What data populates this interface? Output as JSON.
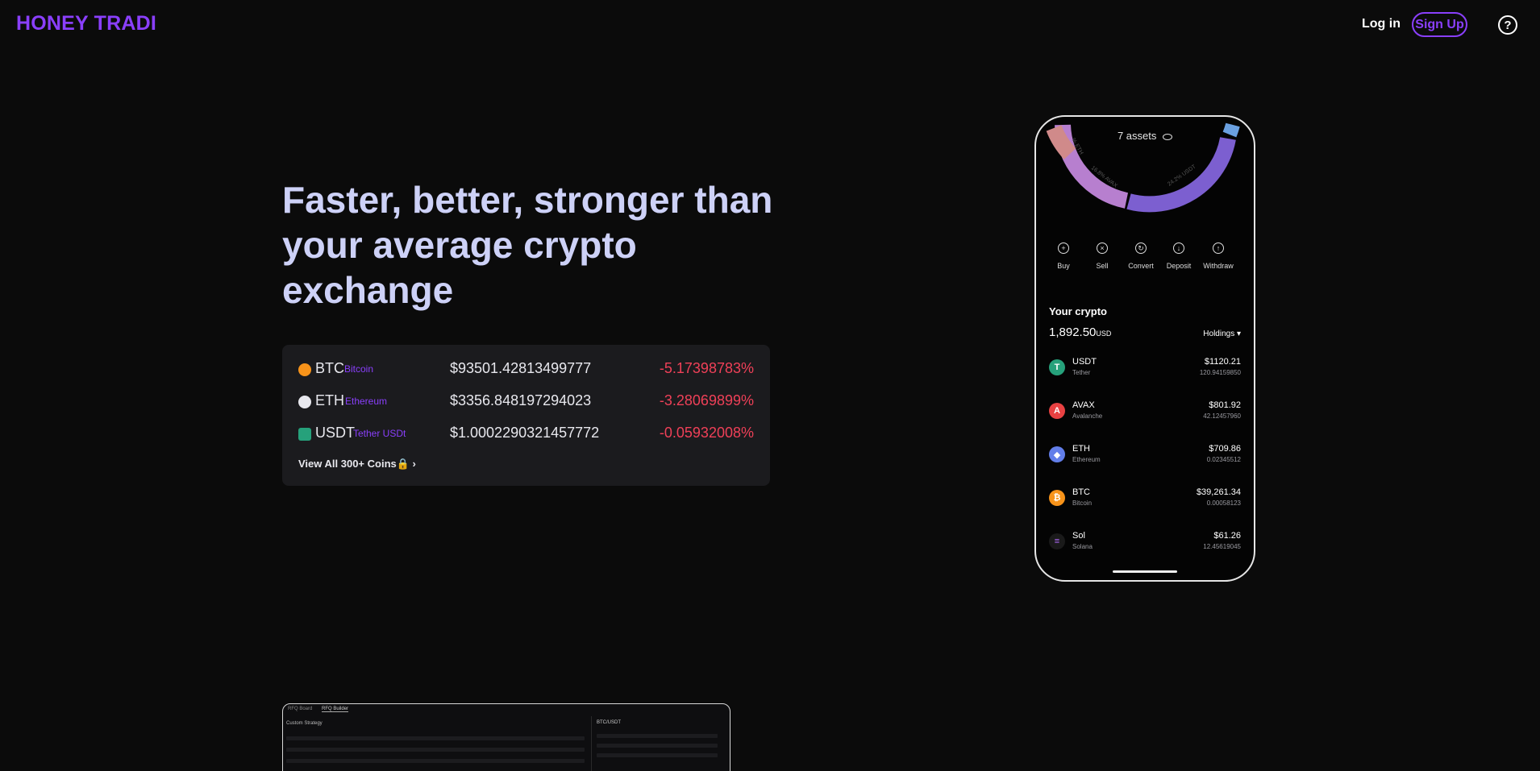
{
  "nav": {
    "brand": "HONEY TRADI",
    "login": "Log in",
    "signup": "Sign Up",
    "help_icon": "?"
  },
  "hero": {
    "headline": "Faster, better, stronger than your average crypto exchange"
  },
  "ticker": {
    "rows": [
      {
        "symbol": "BTC",
        "name": "Bitcoin",
        "price": "$93501.42813499777",
        "change": "-5.17398783%",
        "icon": "bitcoin-icon",
        "color": "#f7931a"
      },
      {
        "symbol": "ETH",
        "name": "Ethereum",
        "price": "$3356.848197294023",
        "change": "-3.28069899%",
        "icon": "ethereum-icon",
        "color": "#e8e8ee"
      },
      {
        "symbol": "USDT",
        "name": "Tether USDt",
        "price": "$1.0002290321457772",
        "change": "-0.05932008%",
        "icon": "tether-icon",
        "color": "#26a17b"
      }
    ],
    "view_all": "View All 300+ Coins🔒 ›"
  },
  "phone": {
    "assets_label": "7 assets",
    "donut_labels": [
      "% ETH",
      "16.8% AVAX",
      "24.2% USDT"
    ],
    "actions": [
      "Buy",
      "Sell",
      "Convert",
      "Deposit",
      "Withdraw"
    ],
    "your_crypto": "Your crypto",
    "total_value": "1,892.50",
    "total_unit": "USD",
    "holdings_label": "Holdings ▾",
    "holdings": [
      {
        "symbol": "USDT",
        "name": "Tether",
        "value": "$1120.21",
        "amount": "120.94159850",
        "icon_color": "#26a17b",
        "glyph": "T"
      },
      {
        "symbol": "AVAX",
        "name": "Avalanche",
        "value": "$801.92",
        "amount": "42.12457960",
        "icon_color": "#e84142",
        "glyph": "A"
      },
      {
        "symbol": "ETH",
        "name": "Ethereum",
        "value": "$709.86",
        "amount": "0.02345512",
        "icon_color": "#627eea",
        "glyph": "◆"
      },
      {
        "symbol": "BTC",
        "name": "Bitcoin",
        "value": "$39,261.34",
        "amount": "0.00058123",
        "icon_color": "#f7931a",
        "glyph": "₿"
      },
      {
        "symbol": "Sol",
        "name": "Solana",
        "value": "$61.26",
        "amount": "12.45619045",
        "icon_color": "#14f195",
        "glyph": "≡"
      }
    ]
  },
  "preview": {
    "tabs": [
      "RFQ Board",
      "RFQ Builder"
    ],
    "title": "Custom Strategy",
    "pair": "BTC/USDT"
  },
  "colors": {
    "accent": "#8a3ffc",
    "headline": "#cdd1f7",
    "negative": "#ef4058",
    "donut_eth": "#d08a8a",
    "donut_avax": "#b77fcf",
    "donut_usdt": "#7c5fd0",
    "donut_other": "#6aa0e0"
  }
}
